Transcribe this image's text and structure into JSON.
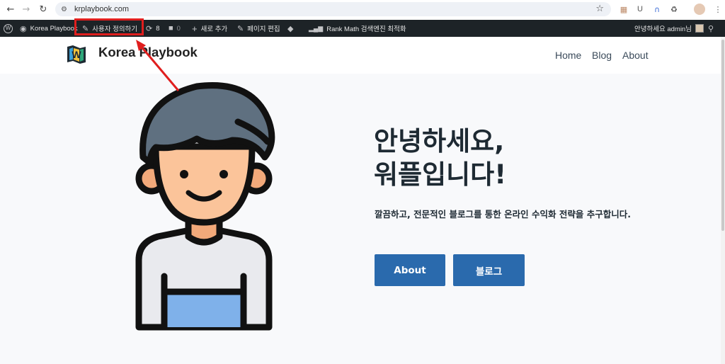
{
  "browser": {
    "url": "krplaybook.com",
    "icons": [
      "back-icon",
      "forward-icon",
      "reload-icon",
      "site-settings-icon",
      "star-icon",
      "extension-icons",
      "profile-icon",
      "menu-icon"
    ]
  },
  "wp_admin_bar": {
    "site_name": "Korea Playbook",
    "customize": "사용자 정의하기",
    "updates_count": "8",
    "comments_count": "0",
    "new": "새로 추가",
    "edit_page": "페이지 편집",
    "rank_math": "Rank Math 검색엔진 최적화",
    "greeting": "안녕하세요 admin님"
  },
  "site": {
    "brand": "Korea Playbook",
    "menu": [
      "Home",
      "Blog",
      "About"
    ]
  },
  "hero": {
    "title_line1": "안녕하세요,",
    "title_line2": "워플입니다!",
    "description": "깔끔하고, 전문적인 블로그를 통한 온라인 수익화 전략을 추구합니다.",
    "button_about": "About",
    "button_blog": "블로그"
  },
  "colors": {
    "admin_bar": "#1d2327",
    "primary_button": "#2a6aad",
    "highlight": "#e01e1e",
    "hero_bg": "#f8f9fb"
  }
}
